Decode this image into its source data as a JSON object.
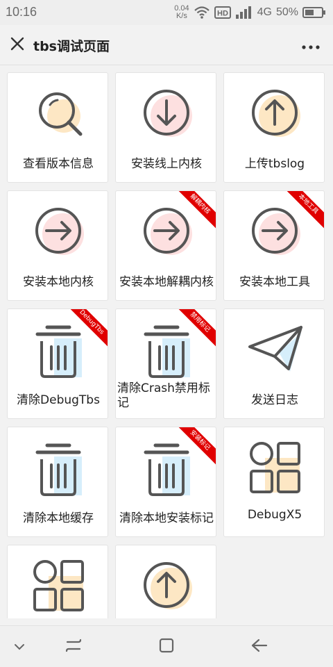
{
  "status_bar": {
    "time": "10:16",
    "net_speed_value": "0.04",
    "net_speed_unit": "K/s",
    "hd_badge": "HD",
    "network_type": "4G",
    "battery": "50%"
  },
  "header": {
    "title": "tbs调试页面",
    "close_icon": "close-icon",
    "more_icon": "more-icon"
  },
  "tiles": [
    {
      "label": "查看版本信息",
      "icon": "search-icon",
      "accent": "#fde7c4"
    },
    {
      "label": "安装线上内核",
      "icon": "download-icon",
      "accent": "#fde0e0"
    },
    {
      "label": "上传tbslog",
      "icon": "upload-icon",
      "accent": "#fde7c4"
    },
    {
      "label": "安装本地内核",
      "icon": "arrow-right-icon",
      "accent": "#fde0e0"
    },
    {
      "label": "安装本地解耦内核",
      "icon": "arrow-right-icon",
      "accent": "#fde0e0",
      "ribbon": "解耦内核"
    },
    {
      "label": "安装本地工具",
      "icon": "arrow-right-icon",
      "accent": "#fde0e0",
      "ribbon": "本地工具"
    },
    {
      "label": "清除DebugTbs",
      "icon": "trash-icon",
      "accent": "#d6eefb",
      "ribbon": "DebugTbs"
    },
    {
      "label": "清除Crash禁用标记",
      "icon": "trash-icon",
      "accent": "#d6eefb",
      "ribbon": "禁用标记"
    },
    {
      "label": "发送日志",
      "icon": "send-icon",
      "accent": "#d6eefb"
    },
    {
      "label": "清除本地缓存",
      "icon": "trash-icon",
      "accent": "#d6eefb"
    },
    {
      "label": "清除本地安装标记",
      "icon": "trash-icon",
      "accent": "#d6eefb",
      "ribbon": "安装标记"
    },
    {
      "label": "DebugX5",
      "icon": "grid-icon",
      "accent": "#fde7c4"
    },
    {
      "label": "",
      "icon": "grid-icon",
      "accent": "#fde7c4"
    },
    {
      "label": "",
      "icon": "upload-icon",
      "accent": "#fde7c4"
    }
  ],
  "nav_bar": {
    "collapse_icon": "chevron-down-icon",
    "recents_icon": "menu-icon",
    "home_icon": "home-icon",
    "back_icon": "back-icon"
  },
  "colors": {
    "icon_stroke": "#555555",
    "ribbon": "#e00000"
  }
}
